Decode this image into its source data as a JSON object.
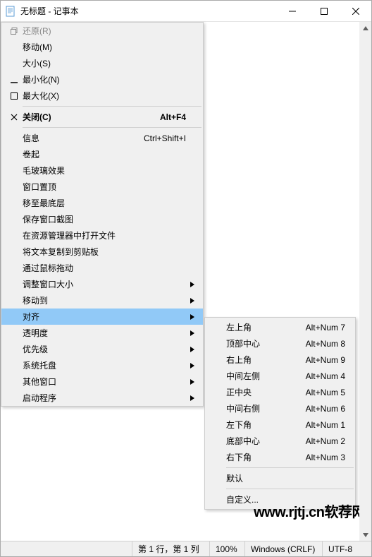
{
  "titlebar": {
    "title": "无标题 - 记事本"
  },
  "main_menu": {
    "items": [
      {
        "label": "还原(R)",
        "shortcut": ""
      },
      {
        "label": "移动(M)",
        "shortcut": ""
      },
      {
        "label": "大小(S)",
        "shortcut": ""
      },
      {
        "label": "最小化(N)",
        "shortcut": ""
      },
      {
        "label": "最大化(X)",
        "shortcut": ""
      },
      {
        "label": "关闭(C)",
        "shortcut": "Alt+F4"
      },
      {
        "label": "信息",
        "shortcut": "Ctrl+Shift+I"
      },
      {
        "label": "卷起",
        "shortcut": ""
      },
      {
        "label": "毛玻璃效果",
        "shortcut": ""
      },
      {
        "label": "窗口置顶",
        "shortcut": ""
      },
      {
        "label": "移至最底层",
        "shortcut": ""
      },
      {
        "label": "保存窗口截图",
        "shortcut": ""
      },
      {
        "label": "在资源管理器中打开文件",
        "shortcut": ""
      },
      {
        "label": "将文本复制到剪贴板",
        "shortcut": ""
      },
      {
        "label": "通过鼠标拖动",
        "shortcut": ""
      },
      {
        "label": "调整窗口大小",
        "shortcut": ""
      },
      {
        "label": "移动到",
        "shortcut": ""
      },
      {
        "label": "对齐",
        "shortcut": ""
      },
      {
        "label": "透明度",
        "shortcut": ""
      },
      {
        "label": "优先级",
        "shortcut": ""
      },
      {
        "label": "系统托盘",
        "shortcut": ""
      },
      {
        "label": "其他窗口",
        "shortcut": ""
      },
      {
        "label": "启动程序",
        "shortcut": ""
      }
    ]
  },
  "submenu_align": {
    "items": [
      {
        "label": "左上角",
        "shortcut": "Alt+Num 7"
      },
      {
        "label": "顶部中心",
        "shortcut": "Alt+Num 8"
      },
      {
        "label": "右上角",
        "shortcut": "Alt+Num 9"
      },
      {
        "label": "中间左侧",
        "shortcut": "Alt+Num 4"
      },
      {
        "label": "正中央",
        "shortcut": "Alt+Num 5"
      },
      {
        "label": "中间右侧",
        "shortcut": "Alt+Num 6"
      },
      {
        "label": "左下角",
        "shortcut": "Alt+Num 1"
      },
      {
        "label": "底部中心",
        "shortcut": "Alt+Num 2"
      },
      {
        "label": "右下角",
        "shortcut": "Alt+Num 3"
      },
      {
        "label": "默认",
        "shortcut": ""
      },
      {
        "label": "自定义...",
        "shortcut": ""
      }
    ]
  },
  "statusbar": {
    "position": "第 1 行，第 1 列",
    "zoom": "100%",
    "line_ending": "Windows (CRLF)",
    "encoding": "UTF-8"
  },
  "watermark": "www.rjtj.cn软荐网"
}
